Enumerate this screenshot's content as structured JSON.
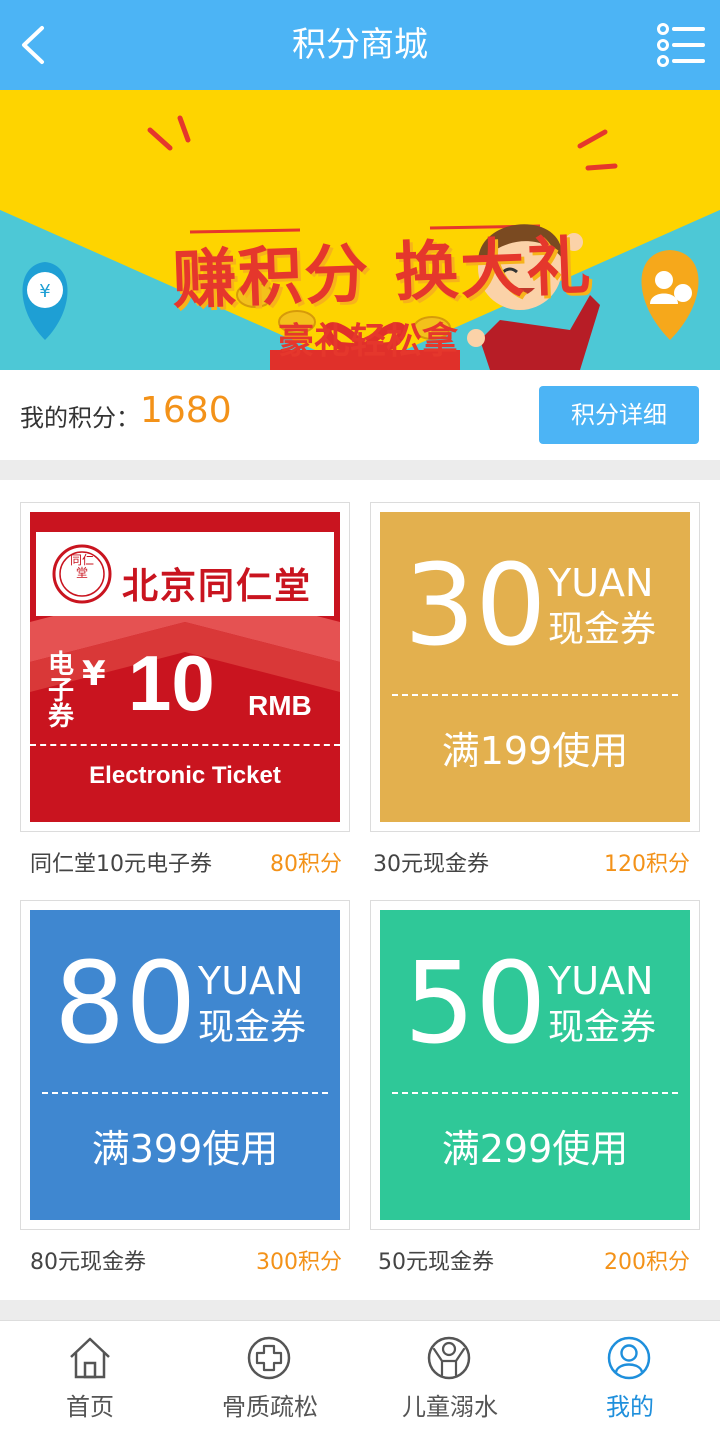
{
  "header": {
    "title": "积分商城",
    "back_icon": "back-arrow-icon",
    "menu_icon": "list-menu-icon"
  },
  "banner": {
    "title": "赚积分 换大礼",
    "subtitle": "豪礼轻松拿"
  },
  "points": {
    "label": "我的积分：",
    "value": "1680",
    "detail_button": "积分详细"
  },
  "products": [
    {
      "name": "同仁堂10元电子券",
      "cost": "80积分",
      "image": {
        "brand": "北京同仁堂",
        "seal": "同仁堂",
        "denomination": "¥",
        "amount": "10",
        "unit": "RMB",
        "type": "电子券",
        "caption": "Electronic Ticket"
      }
    },
    {
      "name": "30元现金券",
      "cost": "120积分",
      "image": {
        "amount": "30",
        "unit": "YUAN",
        "label": "现金券",
        "condition": "满199使用",
        "color": "#e3b04e"
      }
    },
    {
      "name": "80元现金券",
      "cost": "300积分",
      "image": {
        "amount": "80",
        "unit": "YUAN",
        "label": "现金券",
        "condition": "满399使用",
        "color": "#3f87d0"
      }
    },
    {
      "name": "50元现金券",
      "cost": "200积分",
      "image": {
        "amount": "50",
        "unit": "YUAN",
        "label": "现金券",
        "condition": "满299使用",
        "color": "#2fc898"
      }
    }
  ],
  "tabs": [
    {
      "label": "首页",
      "icon": "home-icon"
    },
    {
      "label": "骨质疏松",
      "icon": "medical-cross-icon"
    },
    {
      "label": "儿童溺水",
      "icon": "child-icon"
    },
    {
      "label": "我的",
      "icon": "user-icon",
      "active": true
    }
  ],
  "colors": {
    "header": "#4cb4f5",
    "accent": "#f39219",
    "tab_active": "#1e8fdc"
  }
}
